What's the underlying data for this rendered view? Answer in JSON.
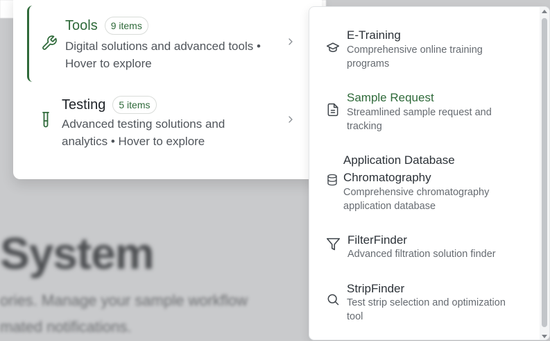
{
  "background": {
    "title": "System",
    "line1": "ories. Manage your sample workflow",
    "line2": "mated notifications."
  },
  "categories": [
    {
      "title": "Tools",
      "badge": "9 items",
      "description": "Digital solutions and advanced tools • Hover to explore",
      "icon": "wrench-icon",
      "active": true
    },
    {
      "title": "Testing",
      "badge": "5 items",
      "description": "Advanced testing solutions and analytics • Hover to explore",
      "icon": "test-tube-icon",
      "active": false
    }
  ],
  "submenu": [
    {
      "title": "E-Training",
      "description": "Comprehensive online training programs",
      "icon": "graduation-cap-icon"
    },
    {
      "title": "Sample Request",
      "description": "Streamlined sample request and tracking",
      "icon": "document-icon",
      "highlight": true
    },
    {
      "title": "Application Database Chromatography",
      "description": "Comprehensive chromatography application database",
      "icon": "database-icon"
    },
    {
      "title": "FilterFinder",
      "description": "Advanced filtration solution finder",
      "icon": "filter-icon"
    },
    {
      "title": "StripFinder",
      "description": "Test strip selection and optimization tool",
      "icon": "search-icon"
    }
  ],
  "colors": {
    "accent": "#2f6a3a",
    "text": "#1f2328",
    "muted": "#666b71"
  }
}
